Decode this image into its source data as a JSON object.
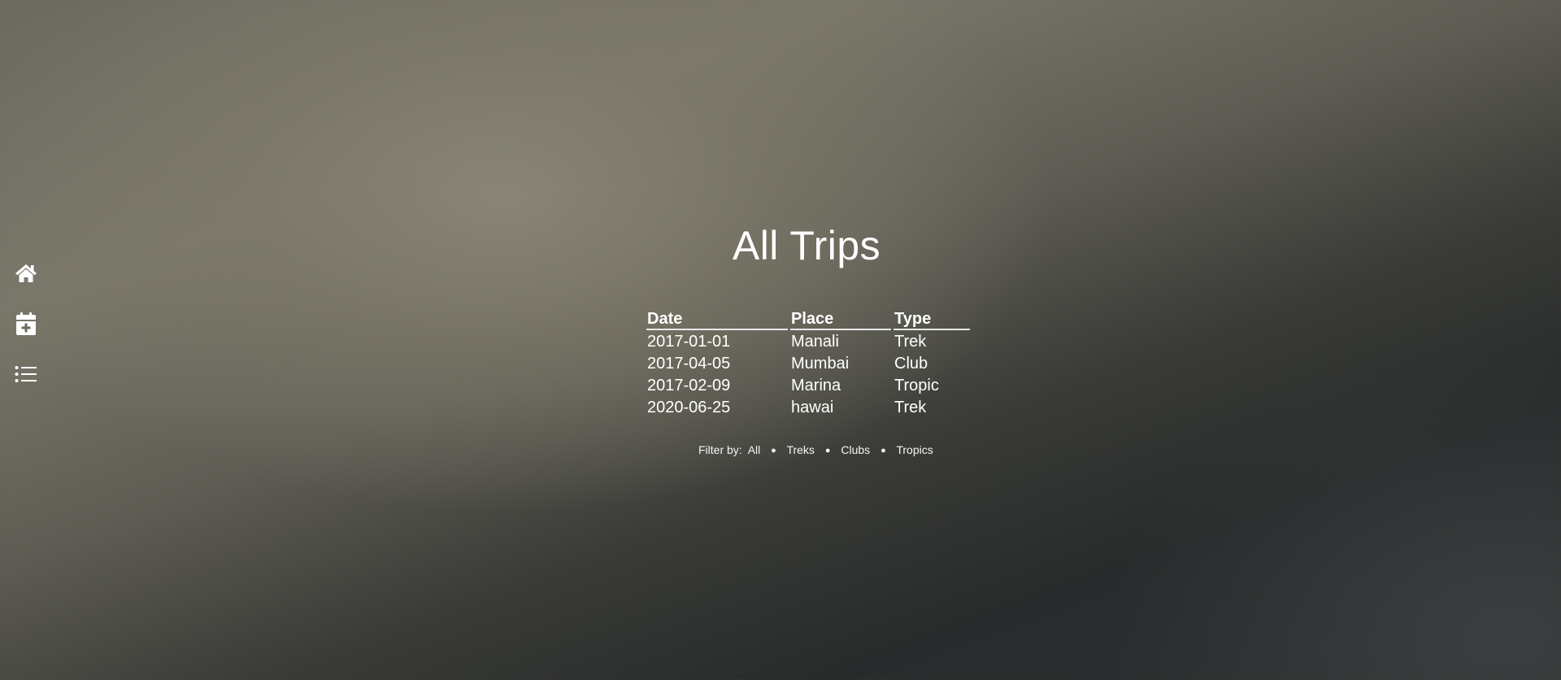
{
  "sidebar": {
    "items": [
      {
        "icon": "home-icon",
        "label": "Home"
      },
      {
        "icon": "calendar-plus-icon",
        "label": "Add trip"
      },
      {
        "icon": "list-icon",
        "label": "All trips"
      }
    ]
  },
  "main": {
    "title": "All Trips",
    "table": {
      "headers": [
        "Date",
        "Place",
        "Type"
      ],
      "rows": [
        [
          "2017-01-01",
          "Manali",
          "Trek"
        ],
        [
          "2017-04-05",
          "Mumbai",
          "Club"
        ],
        [
          "2017-02-09",
          "Marina",
          "Tropic"
        ],
        [
          "2020-06-25",
          "hawai",
          "Trek"
        ]
      ]
    },
    "filter": {
      "label": "Filter by:",
      "options": [
        "All",
        "Treks",
        "Clubs",
        "Tropics"
      ],
      "separator": "●"
    }
  },
  "colors": {
    "text": "#ffffff",
    "background_light": "#85826f",
    "background_dark": "#272b2b"
  }
}
